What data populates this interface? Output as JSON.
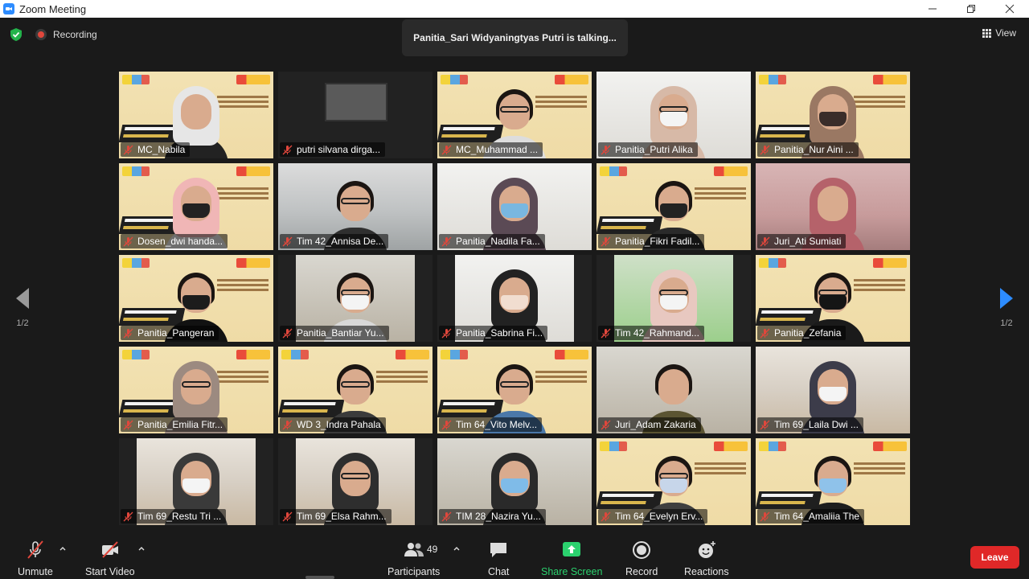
{
  "window": {
    "title": "Zoom Meeting"
  },
  "topbar": {
    "recording_label": "Recording",
    "talking_banner": "Panitia_Sari Widyaningtyas Putri is talking...",
    "view_label": "View"
  },
  "pager": {
    "left_label": "1/2",
    "right_label": "1/2"
  },
  "participants_grid": [
    {
      "name": "MC_Nabila"
    },
    {
      "name": "putri silvana dirga..."
    },
    {
      "name": "MC_Muhammad ..."
    },
    {
      "name": "Panitia_Putri Alika"
    },
    {
      "name": "Panitia_Nur Aini ..."
    },
    {
      "name": "Dosen_dwi handa..."
    },
    {
      "name": "Tim 42_Annisa De..."
    },
    {
      "name": "Panitia_Nadila Fa..."
    },
    {
      "name": "Panitia_Fikri Fadil..."
    },
    {
      "name": "Juri_Ati Sumiati"
    },
    {
      "name": "Panitia_Pangeran"
    },
    {
      "name": "Panitia_Bantiar Yu..."
    },
    {
      "name": "Panitia_Sabrina Fi..."
    },
    {
      "name": "Tim 42_Rahmand..."
    },
    {
      "name": "Panitia_Zefania"
    },
    {
      "name": "Panitia_Emilia Fitr..."
    },
    {
      "name": "WD 3_Indra Pahala"
    },
    {
      "name": "Tim 64_Vito Melv..."
    },
    {
      "name": "Juri_Adam Zakaria"
    },
    {
      "name": "Tim 69_Laila Dwi ..."
    },
    {
      "name": "Tim 69_Restu Tri ..."
    },
    {
      "name": "Tim 69_Elsa Rahm..."
    },
    {
      "name": "TIM 28_Nazira Yu..."
    },
    {
      "name": "Tim 64_Evelyn Erv..."
    },
    {
      "name": "Tim 64_Amaliia The"
    }
  ],
  "toolbar": {
    "unmute_label": "Unmute",
    "start_video_label": "Start Video",
    "participants_label": "Participants",
    "participants_count": "49",
    "chat_label": "Chat",
    "share_screen_label": "Share Screen",
    "record_label": "Record",
    "reactions_label": "Reactions",
    "leave_label": "Leave"
  },
  "colors": {
    "accent_blue": "#2d8cff",
    "share_green": "#2bd16e",
    "leave_red": "#e02828",
    "muted_red": "#e0473c",
    "secure_green": "#23b34b"
  }
}
